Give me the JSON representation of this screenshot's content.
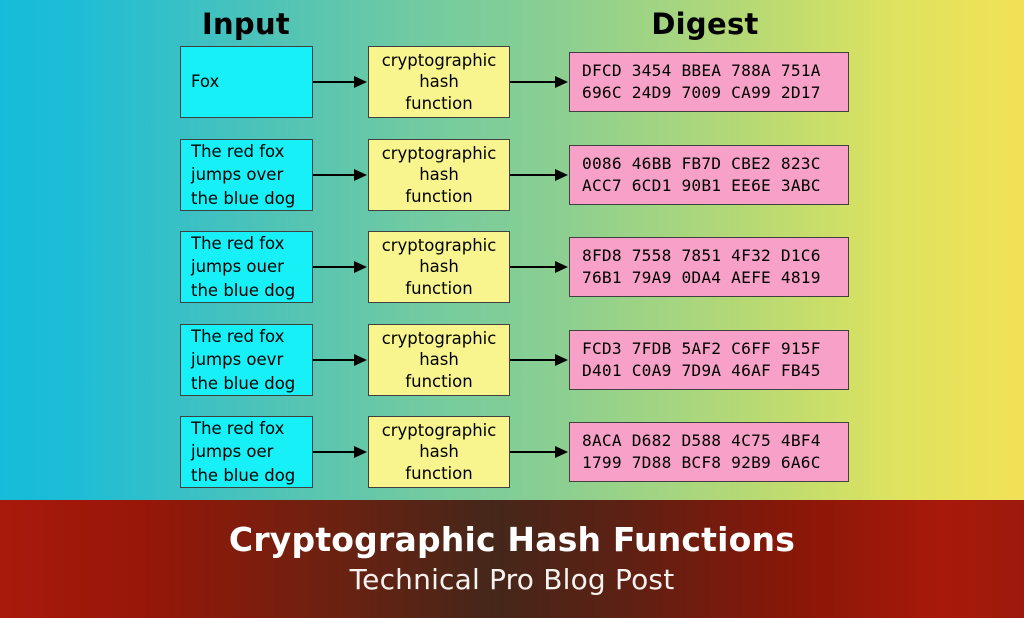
{
  "headers": {
    "input": "Input",
    "digest": "Digest"
  },
  "function_label": {
    "line1": "cryptographic",
    "line2": "hash",
    "line3": "function"
  },
  "rows": [
    {
      "input": {
        "line1": "Fox",
        "line2": "",
        "line3": ""
      },
      "fn": {
        "line1": "cryptographic",
        "line2": "hash",
        "line3": "function"
      },
      "digest": {
        "line1": "DFCD 3454 BBEA 788A 751A",
        "line2": "696C 24D9 7009 CA99 2D17"
      }
    },
    {
      "input": {
        "line1": "The red fox",
        "line2": "jumps over",
        "line3": "the blue dog"
      },
      "fn": {
        "line1": "cryptographic",
        "line2": "hash",
        "line3": "function"
      },
      "digest": {
        "line1": "0086 46BB FB7D CBE2 823C",
        "line2": "ACC7 6CD1 90B1 EE6E 3ABC"
      }
    },
    {
      "input": {
        "line1": "The red fox",
        "line2": "jumps ouer",
        "line3": "the blue dog"
      },
      "fn": {
        "line1": "cryptographic",
        "line2": "hash",
        "line3": "function"
      },
      "digest": {
        "line1": "8FD8 7558 7851 4F32 D1C6",
        "line2": "76B1 79A9 0DA4 AEFE 4819"
      }
    },
    {
      "input": {
        "line1": "The red fox",
        "line2": "jumps oevr",
        "line3": "the blue dog"
      },
      "fn": {
        "line1": "cryptographic",
        "line2": "hash",
        "line3": "function"
      },
      "digest": {
        "line1": "FCD3 7FDB 5AF2 C6FF 915F",
        "line2": "D401 C0A9 7D9A 46AF FB45"
      }
    },
    {
      "input": {
        "line1": "The red fox",
        "line2": "jumps oer",
        "line3": "the blue dog"
      },
      "fn": {
        "line1": "cryptographic",
        "line2": "hash",
        "line3": "function"
      },
      "digest": {
        "line1": "8ACA D682 D588 4C75 4BF4",
        "line2": "1799 7D88 BCF8 92B9 6A6C"
      }
    }
  ],
  "banner": {
    "title": "Cryptographic Hash Functions",
    "subtitle": "Technical Pro Blog Post"
  },
  "colors": {
    "background_left": "#15bcd9",
    "background_mid": "#8ccf91",
    "background_right": "#f2e155",
    "input_box": "#18f0f7",
    "function_box": "#f8f58e",
    "digest_box": "#f7a1c8",
    "box_border": "#404040",
    "arrow": "#000000",
    "banner_red": "#a81a0c",
    "banner_dark": "#45271a",
    "banner_text": "#ffffff"
  }
}
